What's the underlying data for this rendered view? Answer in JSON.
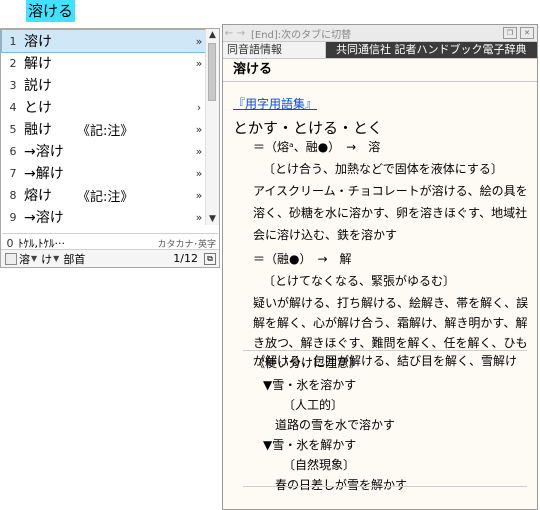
{
  "compose": {
    "text": "溶ける"
  },
  "candidates": [
    {
      "num": "1",
      "text": "溶け",
      "note": "",
      "arrow": "»",
      "selected": true
    },
    {
      "num": "2",
      "text": "解け",
      "note": "",
      "arrow": "»"
    },
    {
      "num": "3",
      "text": "説け",
      "note": "",
      "arrow": ""
    },
    {
      "num": "4",
      "text": "とけ",
      "note": "",
      "arrow": "›"
    },
    {
      "num": "5",
      "text": "融け",
      "note": "《記:注》",
      "arrow": "»"
    },
    {
      "num": "6",
      "text": "→溶け",
      "note": "",
      "arrow": "»"
    },
    {
      "num": "7",
      "text": "→解け",
      "note": "",
      "arrow": "»"
    },
    {
      "num": "8",
      "text": "熔け",
      "note": "《記:注》",
      "arrow": "»"
    },
    {
      "num": "9",
      "text": "→溶け",
      "note": "",
      "arrow": "»"
    }
  ],
  "zero_row": {
    "num": "0",
    "text": "ﾄｹﾙ,ﾄｹﾙ···",
    "type": "カタカナ･英字"
  },
  "status": {
    "mode": "溶",
    "suffix": "け",
    "radical": "部首",
    "count": "1/12"
  },
  "dict": {
    "title": "[End]:次のタブに切替",
    "tab_inactive": "同音語情報",
    "tab_active": "共同通信社 記者ハンドブック電子辞典",
    "headword": "溶ける",
    "link": "『用字用語集』",
    "reading": "とかす・とける・とく",
    "lines": [
      "＝（熔ᵃ、融●）　→　溶",
      "〔とけ合う、加熱などで固体を液体にする〕",
      "アイスクリーム・チョコレートが溶ける、絵の具を",
      "溶く、砂糖を水に溶かす、卵を溶きほぐす、地域社",
      "会に溶け込む、鉄を溶かす",
      "＝（融●）　→　解",
      "〔とけてなくなる、緊張がゆるむ〕",
      "疑いが解ける、打ち解ける、絵解き、帯を解く、誤",
      "解を解く、心が解け合う、霜解け、解き明かす、解",
      "き放つ、解きほぐす、難問を解く、任を解く、ひも",
      "が解ける、包囲が解ける、結び目を解く、雪解け"
    ],
    "note_title": "《使い分けに注意》",
    "notes": [
      "▼雪・氷を溶かす",
      "〔人工的〕",
      "道路の雪を水で溶かす",
      "▼雪・氷を解かす",
      "〔自然現象〕",
      "春の日差しが雪を解かす"
    ]
  }
}
